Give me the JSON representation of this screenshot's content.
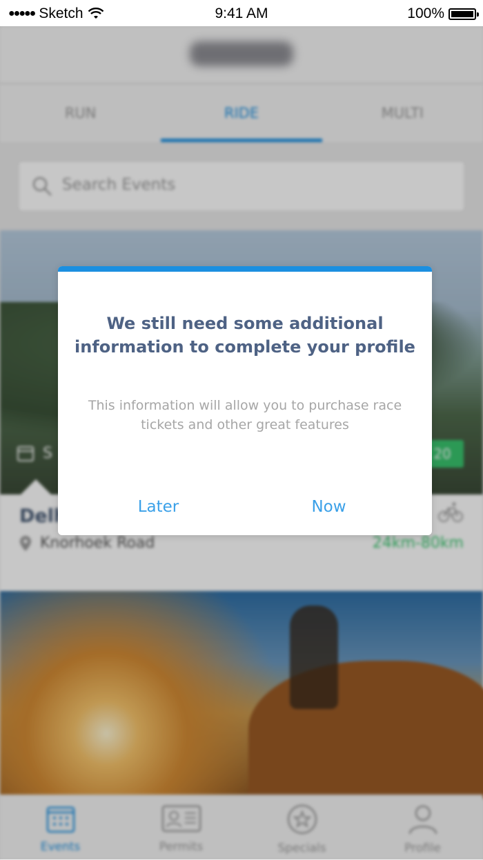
{
  "status_bar": {
    "carrier": "Sketch",
    "time": "9:41 AM",
    "battery": "100%"
  },
  "tabs": [
    {
      "label": "RUN",
      "active": false
    },
    {
      "label": "RIDE",
      "active": true
    },
    {
      "label": "MULTI",
      "active": false
    }
  ],
  "search": {
    "placeholder": "Search Events"
  },
  "event": {
    "date_prefix": "S",
    "price_fragment": "20",
    "name_visible": "Delh",
    "location": "Knorhoek Road",
    "distance": "24km-80km"
  },
  "bottom_nav": [
    {
      "label": "Events",
      "icon": "calendar-icon",
      "active": true
    },
    {
      "label": "Permits",
      "icon": "id-card-icon",
      "active": false
    },
    {
      "label": "Specials",
      "icon": "star-badge-icon",
      "active": false
    },
    {
      "label": "Profile",
      "icon": "user-icon",
      "active": false
    }
  ],
  "modal": {
    "title": "We still need some additional information to complete your profile",
    "body": "This information will allow you to purchase race tickets and other great features",
    "later_label": "Later",
    "now_label": "Now"
  },
  "colors": {
    "accent": "#1b8fe0",
    "green": "#39c46e",
    "title": "#4e6284"
  }
}
